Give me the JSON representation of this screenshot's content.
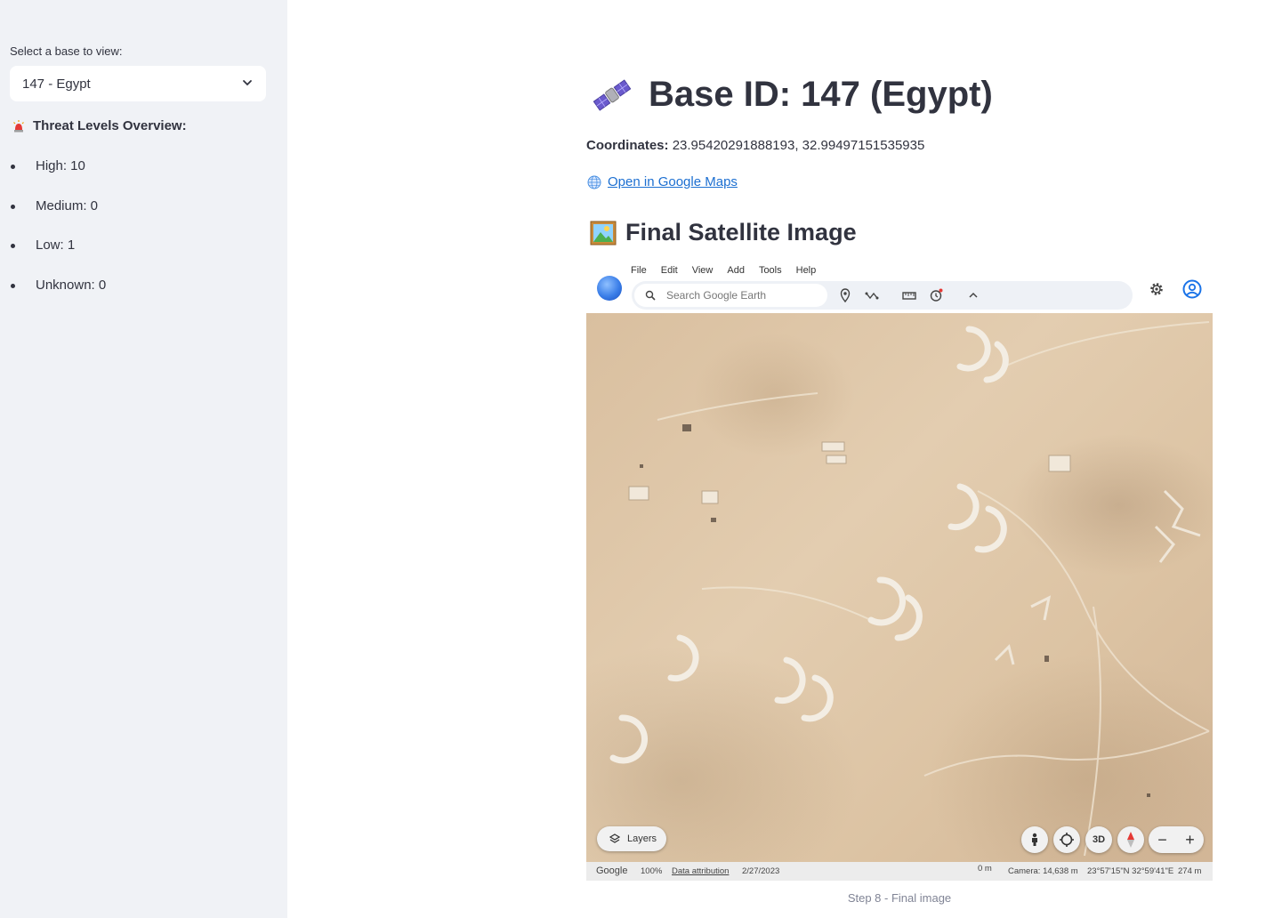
{
  "sidebar": {
    "select_label": "Select a base to view:",
    "selected_base": "147 - Egypt",
    "threat_header": "Threat Levels Overview:",
    "threat_levels": [
      "High: 10",
      "Medium: 0",
      "Low: 1",
      "Unknown: 0"
    ]
  },
  "main": {
    "title": "Base ID: 147 (Egypt)",
    "coords_label": "Coordinates:",
    "coords_value": "23.95420291888193, 32.99497151535935",
    "maps_link": "Open in Google Maps",
    "section_title": "Final Satellite Image",
    "caption": "Step 8 - Final image"
  },
  "earth": {
    "menu": [
      "File",
      "Edit",
      "View",
      "Add",
      "Tools",
      "Help"
    ],
    "search_placeholder": "Search Google Earth",
    "layers_label": "Layers",
    "btn_3d": "3D",
    "footer": {
      "brand": "Google",
      "zoom": "100%",
      "attribution": "Data attribution",
      "date": "2/27/2023",
      "scale": "0 m",
      "camera": "Camera: 14,638 m",
      "position": "23°57'15\"N 32°59'41\"E",
      "elevation": "274 m"
    }
  },
  "colors": {
    "sidebar_bg": "#f0f2f6",
    "text": "#31333f",
    "link": "#1c6fd1",
    "caption": "#808495"
  },
  "icons": [
    "satellite-icon",
    "siren-icon",
    "globe-icon",
    "framed-picture-icon",
    "chevron-down-icon"
  ]
}
